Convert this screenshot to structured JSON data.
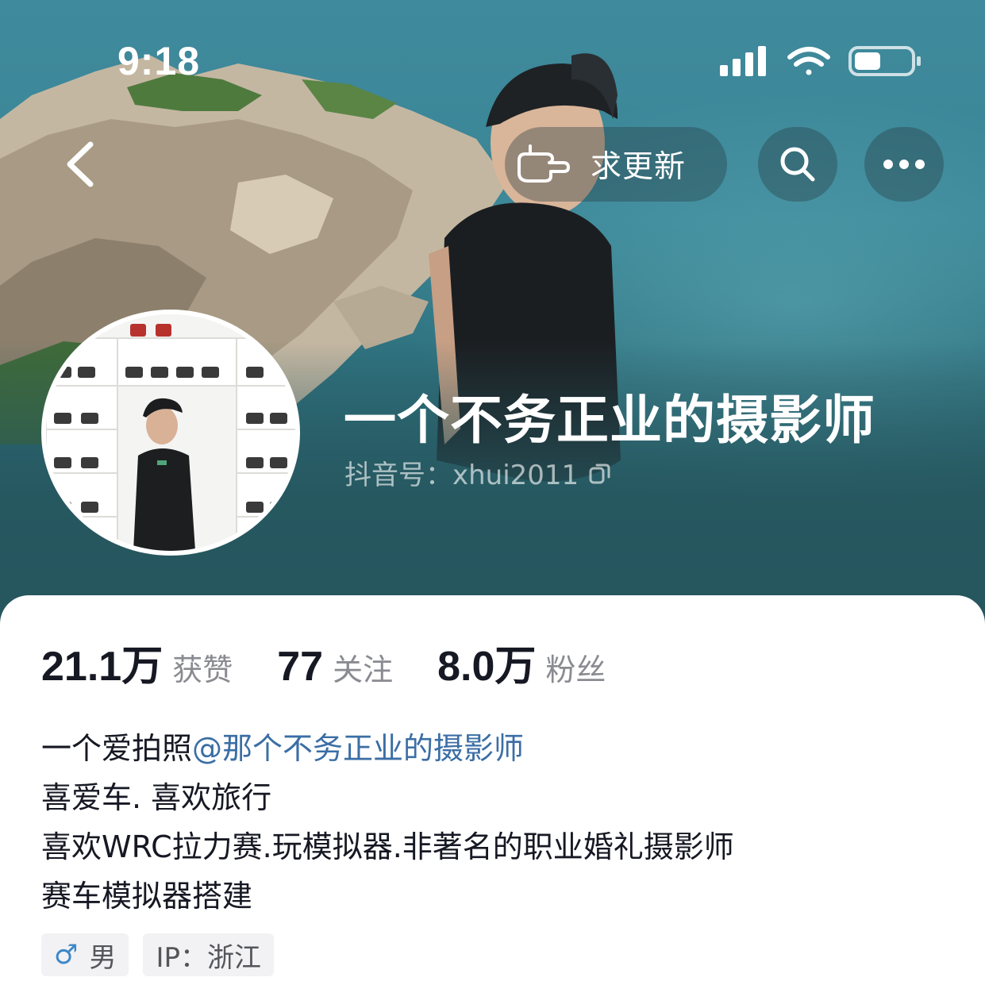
{
  "status_bar": {
    "time": "9:18"
  },
  "header": {
    "update_label": "求更新"
  },
  "profile": {
    "nickname": "一个不务正业的摄影师",
    "account_id": "抖音号：xhui2011"
  },
  "stats": [
    {
      "value": "21.1万",
      "label": "获赞"
    },
    {
      "value": "77",
      "label": "关注"
    },
    {
      "value": "8.0万",
      "label": "粉丝"
    }
  ],
  "bio": {
    "line1_prefix": "一个爱拍照",
    "line1_mention": "@那个不务正业的摄影师",
    "line2": "喜爱车. 喜欢旅行",
    "line3": "喜欢WRC拉力赛.玩模拟器.非著名的职业婚礼摄影师",
    "line4": "赛车模拟器搭建"
  },
  "tags": {
    "gender_icon": "♂",
    "gender": "男",
    "ip": "IP：浙江"
  },
  "icons": [
    "back-chevron-icon",
    "pointing-hand-icon",
    "search-icon",
    "more-dots-icon",
    "copy-icon",
    "signal-icon",
    "wifi-icon",
    "battery-icon",
    "male-icon"
  ],
  "colors": {
    "mention": "#3b6ea5",
    "male": "#3d88c8",
    "cover": "#2e6f7c"
  }
}
